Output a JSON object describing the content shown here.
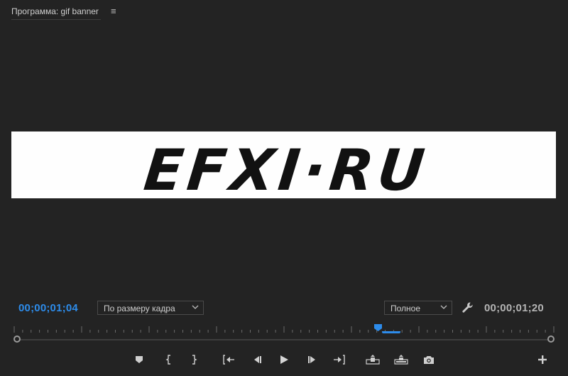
{
  "panel": {
    "title": "Программа: gif banner",
    "menu_glyph": "≡"
  },
  "frame": {
    "banner_text": "EFXI·RU",
    "background_color": "#ffffff",
    "text_color": "#111111"
  },
  "timecode": {
    "current": "00;00;01;04",
    "total": "00;00;01;20",
    "current_color": "#2d8ceb"
  },
  "zoom_select": {
    "value": "По размеру кадра"
  },
  "quality_select": {
    "value": "Полное"
  },
  "playhead": {
    "position_fraction": 0.68
  },
  "controls": [
    {
      "name": "add-marker-button",
      "icon": "marker-icon"
    },
    {
      "name": "mark-in-button",
      "icon": "mark-in-icon"
    },
    {
      "name": "mark-out-button",
      "icon": "mark-out-icon"
    },
    {
      "name": "go-to-in-button",
      "icon": "go-to-in-icon"
    },
    {
      "name": "step-back-button",
      "icon": "step-back-icon"
    },
    {
      "name": "play-button",
      "icon": "play-icon"
    },
    {
      "name": "step-forward-button",
      "icon": "step-forward-icon"
    },
    {
      "name": "go-to-out-button",
      "icon": "go-to-out-icon"
    },
    {
      "name": "lift-button",
      "icon": "lift-icon"
    },
    {
      "name": "extract-button",
      "icon": "extract-icon"
    },
    {
      "name": "export-frame-button",
      "icon": "camera-icon"
    },
    {
      "name": "button-editor-button",
      "icon": "plus-icon"
    }
  ]
}
